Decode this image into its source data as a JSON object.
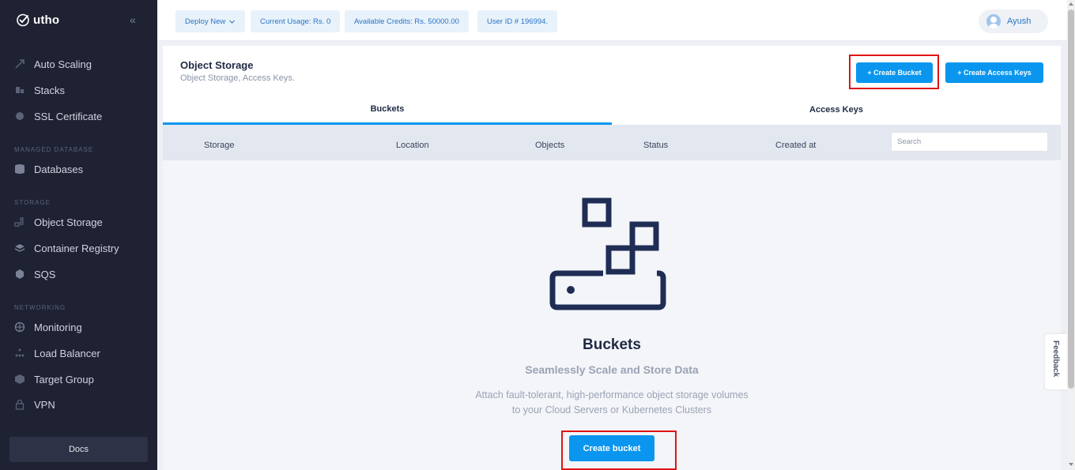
{
  "brand": {
    "name": "utho"
  },
  "sidebar": {
    "items_top": [
      {
        "label": "Auto Scaling",
        "icon": "scaling-icon"
      },
      {
        "label": "Stacks",
        "icon": "stacks-icon"
      },
      {
        "label": "SSL Certificate",
        "icon": "certificate-icon"
      }
    ],
    "sections": [
      {
        "label": "MANAGED DATABASE",
        "items": [
          {
            "label": "Databases",
            "icon": "database-icon"
          }
        ]
      },
      {
        "label": "STORAGE",
        "items": [
          {
            "label": "Object Storage",
            "icon": "object-storage-icon"
          },
          {
            "label": "Container Registry",
            "icon": "registry-icon"
          },
          {
            "label": "SQS",
            "icon": "queue-icon"
          }
        ]
      },
      {
        "label": "NETWORKING",
        "items": [
          {
            "label": "Monitoring",
            "icon": "globe-icon"
          },
          {
            "label": "Load Balancer",
            "icon": "load-balancer-icon"
          },
          {
            "label": "Target Group",
            "icon": "target-group-icon"
          },
          {
            "label": "VPN",
            "icon": "lock-icon"
          }
        ]
      }
    ],
    "docs_label": "Docs"
  },
  "topbar": {
    "deploy_label": "Deploy New",
    "usage_label": "Current Usage: Rs. 0",
    "credits_label": "Available Credits: Rs. 50000.00",
    "user_id_label": "User ID # 196994.",
    "user_name": "Ayush"
  },
  "page": {
    "title": "Object Storage",
    "subtitle": "Object Storage, Access Keys.",
    "create_bucket_label": "+ Create Bucket",
    "create_access_keys_label": "+ Create Access Keys",
    "tabs": [
      {
        "label": "Buckets",
        "active": true
      },
      {
        "label": "Access Keys",
        "active": false
      }
    ]
  },
  "table": {
    "columns": [
      "Storage",
      "Location",
      "Objects",
      "Status",
      "Created at"
    ],
    "search_placeholder": "Search"
  },
  "empty_state": {
    "title": "Buckets",
    "subtitle": "Seamlessly Scale and Store Data",
    "description_line1": "Attach fault-tolerant, high-performance object storage volumes",
    "description_line2": "to your Cloud Servers or Kubernetes Clusters",
    "button_label": "Create bucket",
    "illustration": "bucket-boxes-icon"
  },
  "feedback_label": "Feedback",
  "colors": {
    "accent": "#0a96ee",
    "sidebar_bg": "#1e2233",
    "highlight": "#e01414",
    "illustration": "#1f2d55"
  }
}
